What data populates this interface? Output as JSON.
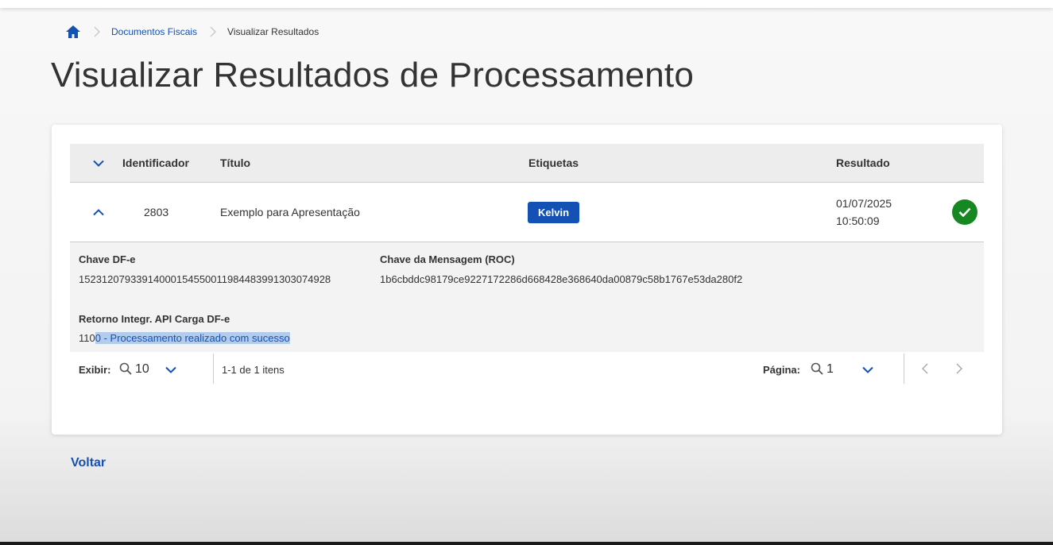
{
  "breadcrumb": {
    "items": [
      {
        "label": "Documentos Fiscais"
      },
      {
        "label": "Visualizar Resultados"
      }
    ]
  },
  "page": {
    "title": "Visualizar Resultados de Processamento"
  },
  "table": {
    "headers": {
      "identifier": "Identificador",
      "title": "Título",
      "tags": "Etiquetas",
      "result": "Resultado"
    },
    "rows": [
      {
        "id": "2803",
        "title": "Exemplo para Apresentação",
        "tag": "Kelvin",
        "result_date": "01/07/2025",
        "result_time": "10:50:09",
        "status_color": "#168821"
      }
    ]
  },
  "details": {
    "dfe_key_label": "Chave DF-e",
    "dfe_key_value": "15231207933914000154550011984483991303074928",
    "message_key_label": "Chave da Mensagem (ROC)",
    "message_key_value": "1b6cbddc98179ce9227172286d668428e368640da00879c58b1767e53da280f2",
    "return_label": "Retorno Integr. API Carga DF-e",
    "return_value_plain": "110",
    "return_value_selected": "0 - Processamento realizado com sucesso"
  },
  "pagination": {
    "show_label": "Exibir:",
    "page_size": "10",
    "range_text": "1-1 de 1 itens",
    "page_label": "Página:",
    "page_value": "1"
  },
  "actions": {
    "back_label": "Voltar"
  },
  "colors": {
    "primary": "#1351b4",
    "success": "#168821",
    "header_bg": "#ededed",
    "details_bg": "#f3f3f3",
    "selection_bg": "#b4ccec"
  },
  "icons": {
    "breadcrumb_home": "home-icon",
    "breadcrumb_separator": "chevron-right-icon",
    "expand_all": "chevron-down-icon",
    "collapse_row": "chevron-up-icon",
    "status": "check-circle-icon",
    "search": "search-icon",
    "prev": "chevron-left-icon",
    "next": "chevron-right-icon"
  }
}
